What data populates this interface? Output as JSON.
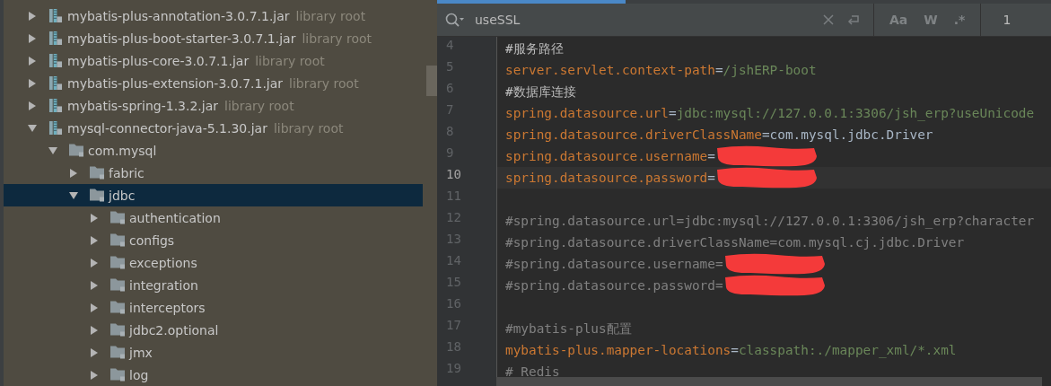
{
  "project_tree": [
    {
      "label": "mybatis-plus-annotation-3.0.7.1.jar",
      "note": "library root",
      "kind": "jar",
      "expanded": false,
      "selected": false
    },
    {
      "label": "mybatis-plus-boot-starter-3.0.7.1.jar",
      "note": "library root",
      "kind": "jar",
      "expanded": false,
      "selected": false
    },
    {
      "label": "mybatis-plus-core-3.0.7.1.jar",
      "note": "library root",
      "kind": "jar",
      "expanded": false,
      "selected": false
    },
    {
      "label": "mybatis-plus-extension-3.0.7.1.jar",
      "note": "library root",
      "kind": "jar",
      "expanded": false,
      "selected": false
    },
    {
      "label": "mybatis-spring-1.3.2.jar",
      "note": "library root",
      "kind": "jar",
      "expanded": false,
      "selected": false
    },
    {
      "label": "mysql-connector-java-5.1.30.jar",
      "note": "library root",
      "kind": "jar",
      "expanded": true,
      "selected": false,
      "children": [
        {
          "label": "com.mysql",
          "kind": "folder",
          "expanded": true,
          "selected": false,
          "children": [
            {
              "label": "fabric",
              "kind": "folder",
              "expanded": false,
              "selected": false
            },
            {
              "label": "jdbc",
              "kind": "folder",
              "expanded": true,
              "selected": true,
              "children": [
                {
                  "label": "authentication",
                  "kind": "folder",
                  "expanded": false,
                  "selected": false
                },
                {
                  "label": "configs",
                  "kind": "folder",
                  "expanded": false,
                  "selected": false
                },
                {
                  "label": "exceptions",
                  "kind": "folder",
                  "expanded": false,
                  "selected": false
                },
                {
                  "label": "integration",
                  "kind": "folder",
                  "expanded": false,
                  "selected": false
                },
                {
                  "label": "interceptors",
                  "kind": "folder",
                  "expanded": false,
                  "selected": false
                },
                {
                  "label": "jdbc2.optional",
                  "kind": "folder",
                  "expanded": false,
                  "selected": false
                },
                {
                  "label": "jmx",
                  "kind": "folder",
                  "expanded": false,
                  "selected": false
                },
                {
                  "label": "log",
                  "kind": "folder",
                  "expanded": false,
                  "selected": false
                }
              ]
            }
          ]
        }
      ]
    }
  ],
  "search": {
    "value": "useSSL",
    "options": [
      {
        "label": "Aa",
        "on": false
      },
      {
        "label": "W",
        "on": false
      },
      {
        "label": ".*",
        "on": false
      }
    ],
    "match_count": "1"
  },
  "editor": {
    "lines": [
      {
        "number": "4",
        "current": false,
        "segments": [
          {
            "kind": "note",
            "text": "#服务路径"
          }
        ]
      },
      {
        "number": "5",
        "current": false,
        "segments": [
          {
            "kind": "key",
            "text": "server.servlet.context-path"
          },
          {
            "kind": "plain",
            "text": "="
          },
          {
            "kind": "value",
            "text": "/jshERP-boot"
          }
        ]
      },
      {
        "number": "6",
        "current": false,
        "segments": [
          {
            "kind": "note",
            "text": "#数据库连接"
          }
        ]
      },
      {
        "number": "7",
        "current": false,
        "segments": [
          {
            "kind": "key",
            "text": "spring.datasource.url"
          },
          {
            "kind": "plain",
            "text": "="
          },
          {
            "kind": "value",
            "text": "jdbc:mysql://127.0.0.1:3306/jsh_erp?useUnicode"
          }
        ]
      },
      {
        "number": "8",
        "current": false,
        "segments": [
          {
            "kind": "key",
            "text": "spring.datasource.driverClassName"
          },
          {
            "kind": "plain",
            "text": "="
          },
          {
            "kind": "class",
            "text": "com.mysql.jdbc.Driver"
          }
        ]
      },
      {
        "number": "9",
        "current": false,
        "segments": [
          {
            "kind": "key",
            "text": "spring.datasource.username"
          },
          {
            "kind": "plain",
            "text": "="
          },
          {
            "kind": "redacted"
          }
        ]
      },
      {
        "number": "10",
        "current": true,
        "segments": [
          {
            "kind": "key",
            "text": "spring.datasource.password"
          },
          {
            "kind": "plain",
            "text": "="
          },
          {
            "kind": "redacted"
          }
        ]
      },
      {
        "number": "11",
        "current": false
      },
      {
        "number": "12",
        "current": false,
        "segments": [
          {
            "kind": "comment",
            "text": "#spring.datasource.url=jdbc:mysql://127.0.0.1:3306/jsh_erp?character"
          }
        ]
      },
      {
        "number": "13",
        "current": false,
        "segments": [
          {
            "kind": "comment",
            "text": "#spring.datasource.driverClassName=com.mysql.cj.jdbc.Driver"
          }
        ]
      },
      {
        "number": "14",
        "current": false,
        "segments": [
          {
            "kind": "comment",
            "text": "#spring.datasource.username="
          },
          {
            "kind": "redacted"
          }
        ]
      },
      {
        "number": "15",
        "current": false,
        "segments": [
          {
            "kind": "comment",
            "text": "#spring.datasource.password="
          },
          {
            "kind": "redacted"
          }
        ]
      },
      {
        "number": "16",
        "current": false
      },
      {
        "number": "17",
        "current": false,
        "segments": [
          {
            "kind": "comment",
            "text": "#mybatis-plus配置"
          }
        ]
      },
      {
        "number": "18",
        "current": false,
        "segments": [
          {
            "kind": "key",
            "text": "mybatis-plus.mapper-locations"
          },
          {
            "kind": "plain",
            "text": "="
          },
          {
            "kind": "value",
            "text": "classpath:./mapper_xml/*.xml"
          }
        ]
      },
      {
        "number": "19",
        "current": false,
        "segments": [
          {
            "kind": "comment",
            "text": "# Redis"
          }
        ]
      }
    ]
  }
}
